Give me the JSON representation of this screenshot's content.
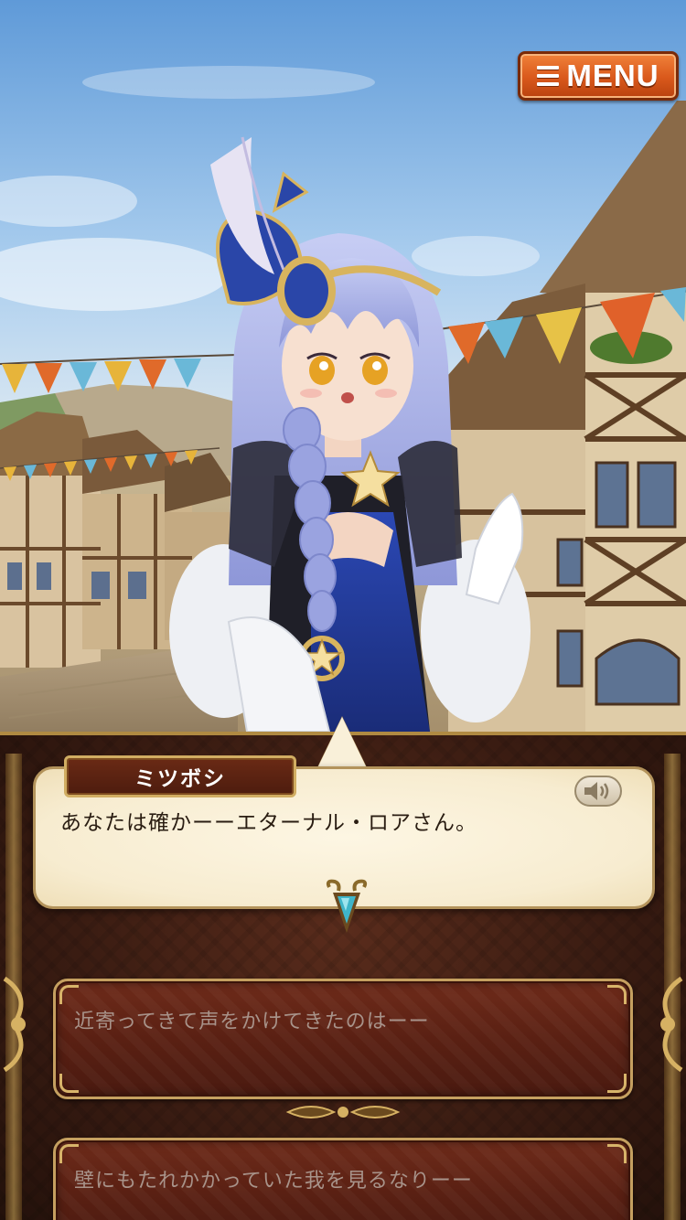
{
  "menu": {
    "label": "MENU",
    "icon": "hamburger-icon"
  },
  "dialogue": {
    "speaker_name": "ミツボシ",
    "text": "あなたは確かーーエターナル・ロアさん。",
    "voice_icon": "speaker-icon",
    "advance_icon": "gem-arrow-icon"
  },
  "choices": [
    {
      "label": "近寄ってきて声をかけてきたのはーー"
    },
    {
      "label": "壁にもたれかかっていた我を見るなりーー"
    }
  ],
  "colors": {
    "menu_orange": "#d9581b",
    "panel_brown": "#3a1c12",
    "bubble_cream": "#f7ecd0",
    "gold_trim": "#c5a060",
    "character_hair": "#a9b3e8",
    "character_ribbon": "#2a46a8"
  }
}
